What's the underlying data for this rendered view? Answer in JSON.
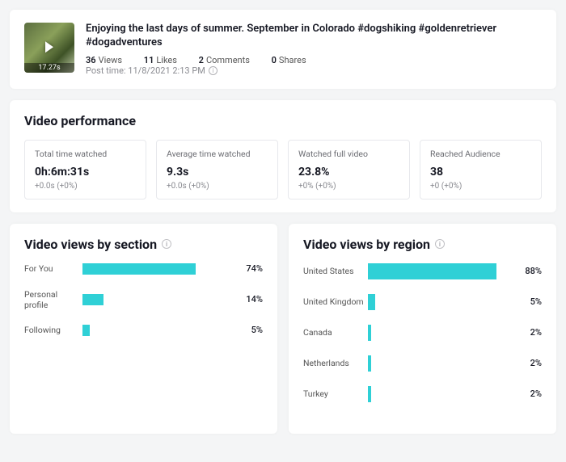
{
  "video": {
    "title": "Enjoying the last days of summer. September in Colorado #dogshiking #goldenretriever #dogadventures",
    "duration": "17.27s",
    "stats": {
      "views": {
        "n": "36",
        "label": "Views"
      },
      "likes": {
        "n": "11",
        "label": "Likes"
      },
      "comments": {
        "n": "2",
        "label": "Comments"
      },
      "shares": {
        "n": "0",
        "label": "Shares"
      }
    },
    "post_time_label": "Post time: 11/8/2021 2:13 PM"
  },
  "performance": {
    "section_title": "Video performance",
    "metrics": [
      {
        "label": "Total time watched",
        "value": "0h:6m:31s",
        "delta": "+0.0s (+0%)"
      },
      {
        "label": "Average time watched",
        "value": "9.3s",
        "delta": "+0.0s (+0%)"
      },
      {
        "label": "Watched full video",
        "value": "23.8%",
        "delta": "+0% (+0%)"
      },
      {
        "label": "Reached Audience",
        "value": "38",
        "delta": "+0 (+0%)"
      }
    ]
  },
  "section_chart": {
    "title": "Video views by section",
    "rows": [
      {
        "label": "For You",
        "pct": 74,
        "pct_label": "74%"
      },
      {
        "label": "Personal profile",
        "pct": 14,
        "pct_label": "14%"
      },
      {
        "label": "Following",
        "pct": 5,
        "pct_label": "5%"
      }
    ]
  },
  "region_chart": {
    "title": "Video views by region",
    "rows": [
      {
        "label": "United States",
        "pct": 88,
        "pct_label": "88%"
      },
      {
        "label": "United Kingdom",
        "pct": 5,
        "pct_label": "5%"
      },
      {
        "label": "Canada",
        "pct": 2,
        "pct_label": "2%"
      },
      {
        "label": "Netherlands",
        "pct": 2,
        "pct_label": "2%"
      },
      {
        "label": "Turkey",
        "pct": 2,
        "pct_label": "2%"
      }
    ]
  },
  "colors": {
    "bar": "#2fd0d6"
  },
  "chart_data": [
    {
      "type": "bar",
      "title": "Video views by section",
      "xlabel": "",
      "ylabel": "",
      "categories": [
        "For You",
        "Personal profile",
        "Following"
      ],
      "values": [
        74,
        14,
        5
      ],
      "unit": "percent",
      "orientation": "horizontal",
      "xlim": [
        0,
        100
      ]
    },
    {
      "type": "bar",
      "title": "Video views by region",
      "xlabel": "",
      "ylabel": "",
      "categories": [
        "United States",
        "United Kingdom",
        "Canada",
        "Netherlands",
        "Turkey"
      ],
      "values": [
        88,
        5,
        2,
        2,
        2
      ],
      "unit": "percent",
      "orientation": "horizontal",
      "xlim": [
        0,
        100
      ]
    }
  ]
}
